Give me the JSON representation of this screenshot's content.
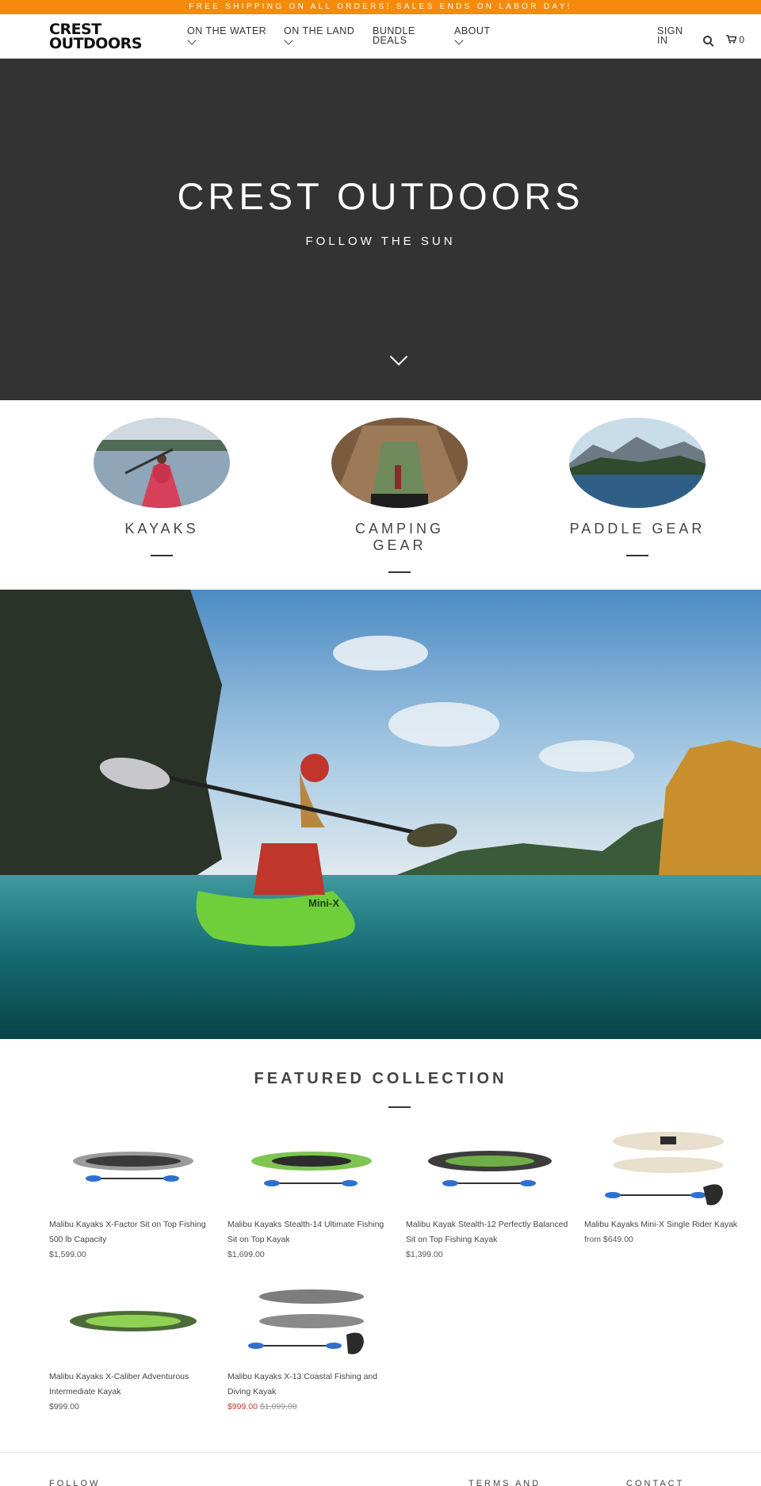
{
  "announcement": "FREE SHIPPING ON ALL ORDERS! SALES ENDS ON LABOR DAY!",
  "logo": {
    "line1": "CREST",
    "line2": "OUTDOORS"
  },
  "nav": [
    {
      "label": "ON THE WATER",
      "has_dropdown": true
    },
    {
      "label": "ON THE LAND",
      "has_dropdown": true
    },
    {
      "label": "BUNDLE DEALS",
      "has_dropdown": false
    },
    {
      "label": "ABOUT",
      "has_dropdown": true
    }
  ],
  "header": {
    "signin": "SIGN IN",
    "cart_count": "0"
  },
  "hero": {
    "title": "CREST OUTDOORS",
    "subtitle": "FOLLOW THE SUN"
  },
  "categories": [
    {
      "label": "KAYAKS"
    },
    {
      "label": "CAMPING GEAR"
    },
    {
      "label": "PADDLE GEAR"
    }
  ],
  "featured": {
    "title": "FEATURED COLLECTION",
    "products": [
      {
        "name": "Malibu Kayaks X-Factor Sit on Top Fishing 500 lb Capacity",
        "price": "$1,599.00"
      },
      {
        "name": "Malibu Kayaks Stealth-14 Ultimate Fishing Sit on Top Kayak",
        "price": "$1,699.00"
      },
      {
        "name": "Malibu Kayak Stealth-12 Perfectly Balanced Sit on Top Fishing Kayak",
        "price": "$1,399.00"
      },
      {
        "name": "Malibu Kayaks Mini-X Single Rider Kayak",
        "price": "from $649.00"
      },
      {
        "name": "Malibu Kayaks X-Caliber Adventurous Intermediate Kayak",
        "price": "$999.00"
      },
      {
        "name": "Malibu Kayaks X-13 Coastal Fishing and Diving Kayak",
        "sale_price": "$999.00",
        "old_price": "$1,099.00"
      }
    ]
  },
  "footer": {
    "follow": "FOLLOW",
    "terms": "TERMS AND",
    "contact": "CONTACT"
  },
  "colors": {
    "accent": "#f58a0b",
    "hero_bg": "#333333",
    "sale": "#c0392b"
  }
}
